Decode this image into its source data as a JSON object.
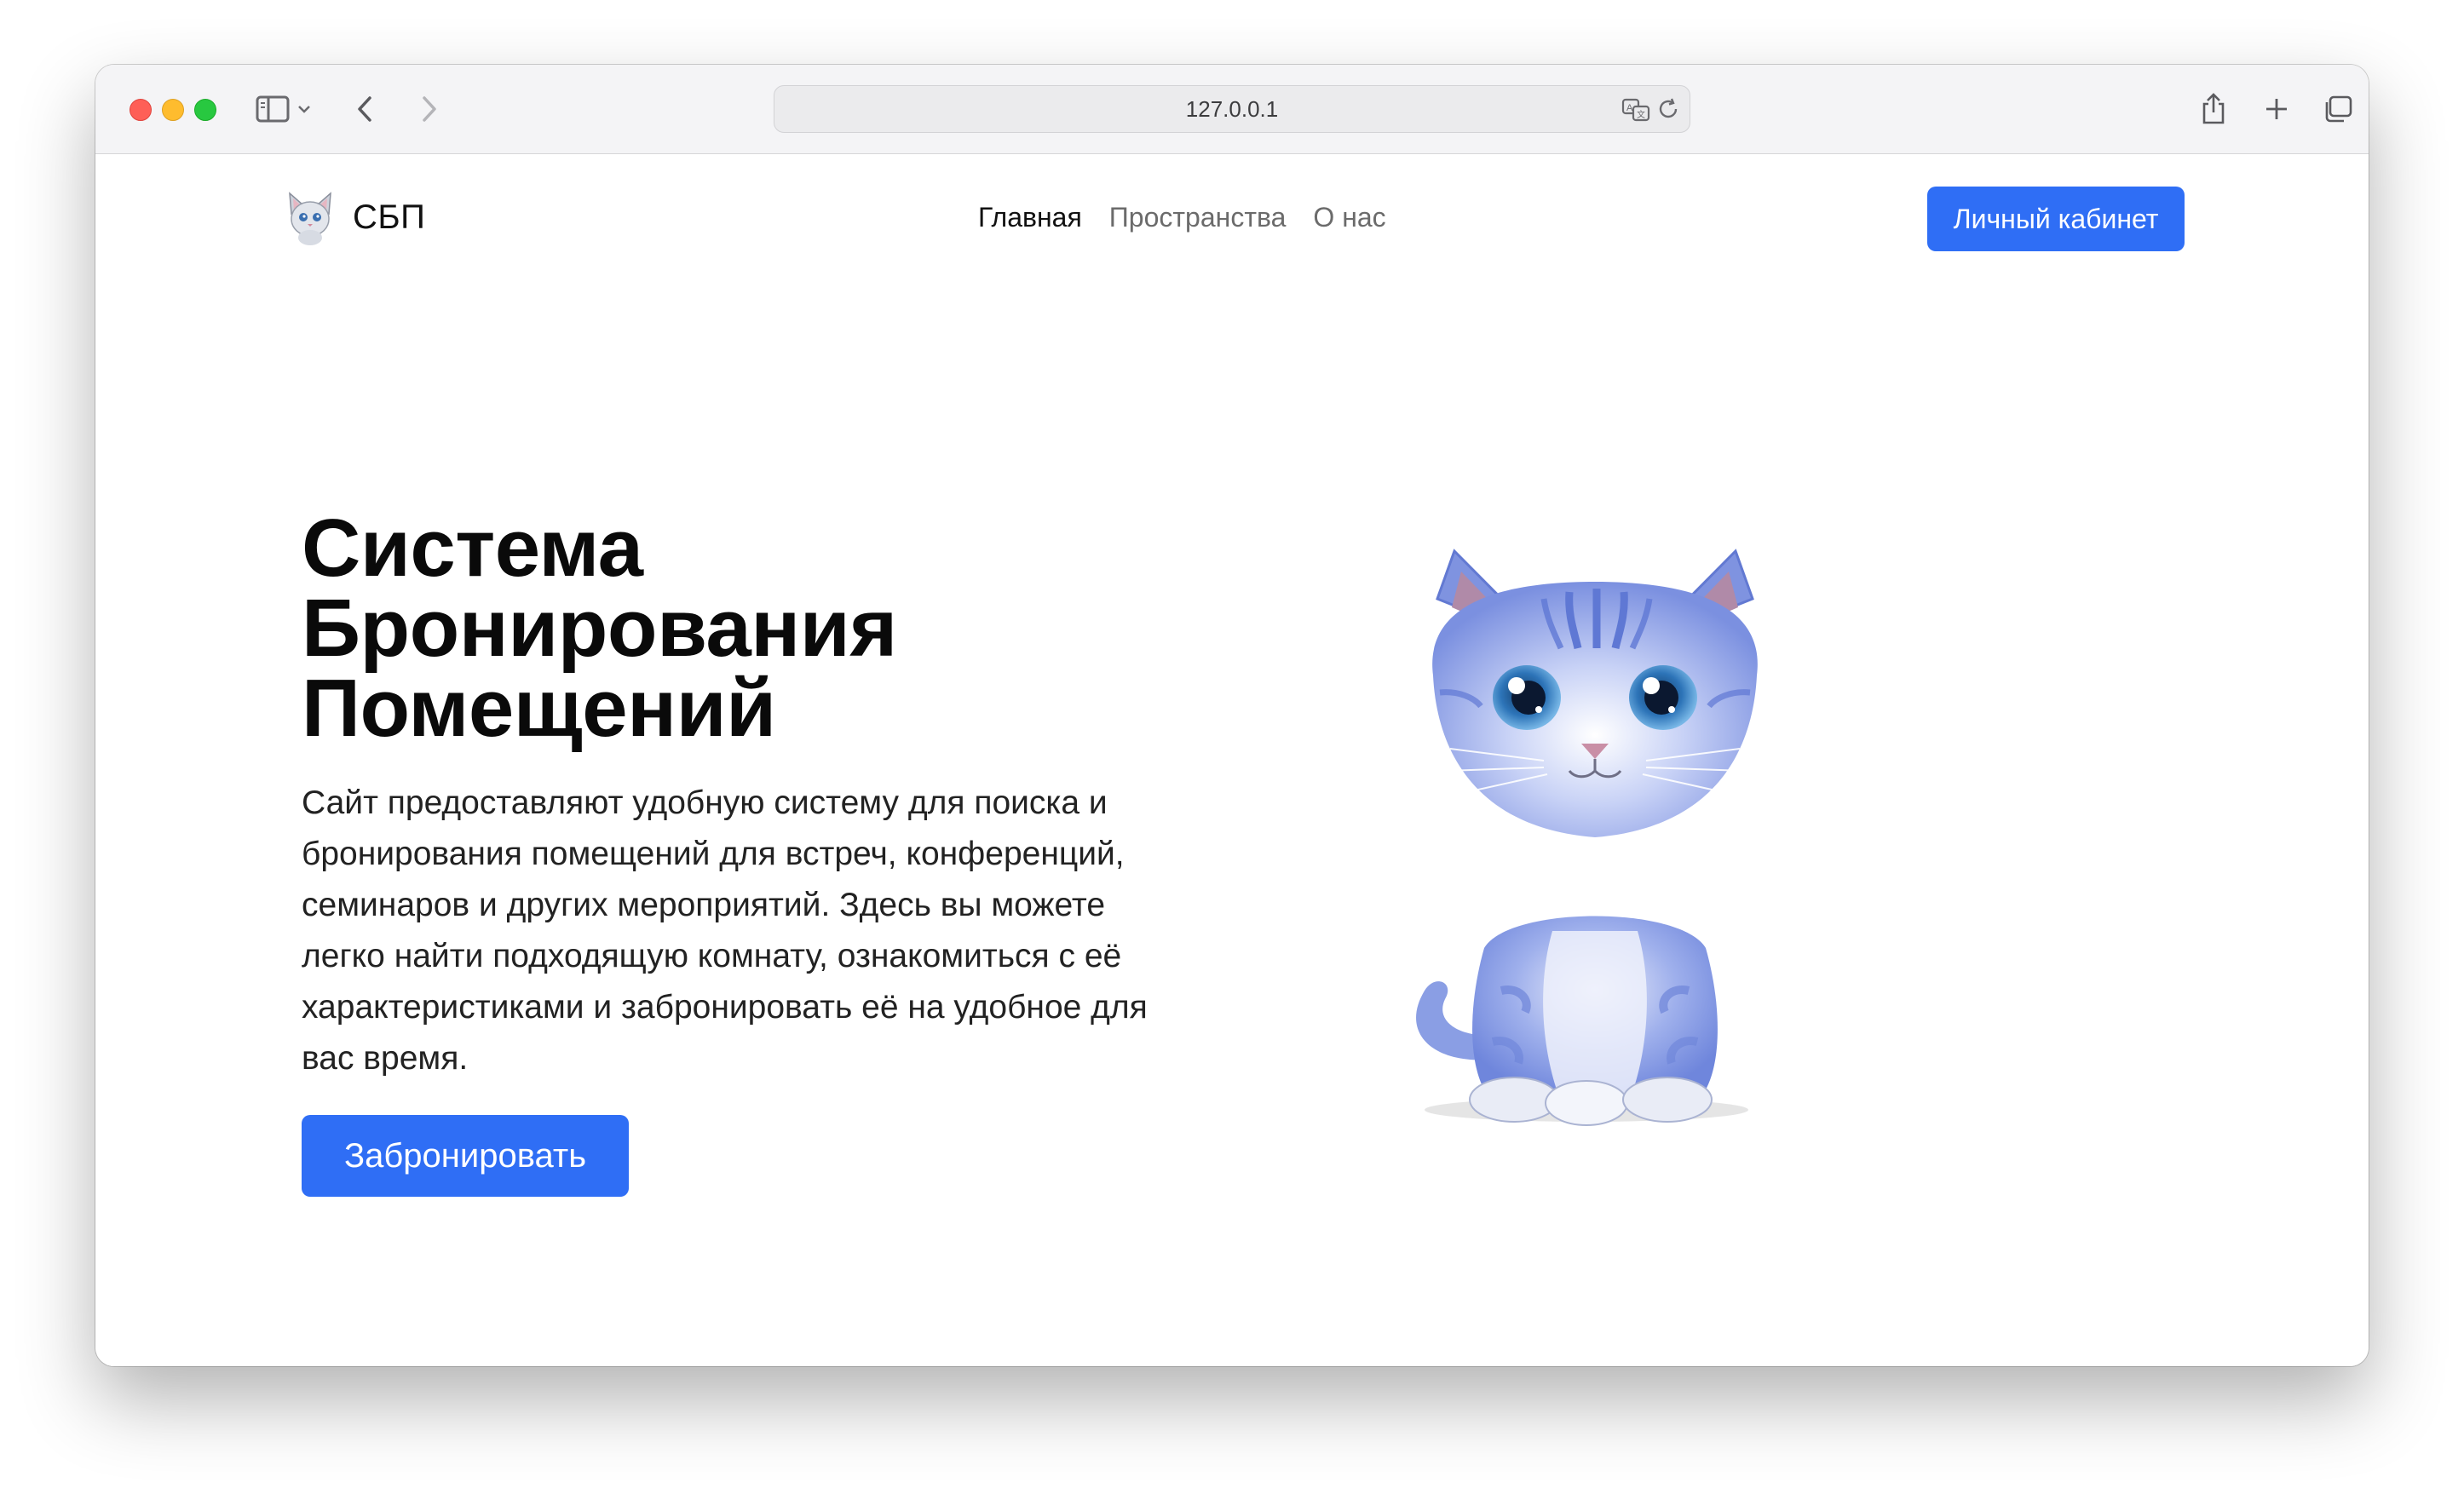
{
  "browser": {
    "url": "127.0.0.1"
  },
  "site": {
    "brand": "СБП",
    "nav": [
      {
        "label": "Главная",
        "active": true
      },
      {
        "label": "Пространства",
        "active": false
      },
      {
        "label": "О нас",
        "active": false
      }
    ],
    "account_button": "Личный кабинет"
  },
  "hero": {
    "title_line1": "Система",
    "title_line2": "Бронирования",
    "title_line3": "Помещений",
    "description": "Сайт предоставляют удобную систему для поиска и бронирования помещений для встреч, конференций, семинаров и других мероприятий. Здесь вы можете легко найти подходящую комнату, ознакомиться с её характеристиками и забронировать её на удобное для вас время.",
    "cta_button": "Забронировать"
  },
  "colors": {
    "accent": "#2f6ef5"
  },
  "icons": [
    "sidebar-icon",
    "chevron-down-icon",
    "back-icon",
    "forward-icon",
    "translate-icon",
    "reload-icon",
    "share-icon",
    "new-tab-icon",
    "tabs-overview-icon",
    "cat-logo-icon"
  ]
}
